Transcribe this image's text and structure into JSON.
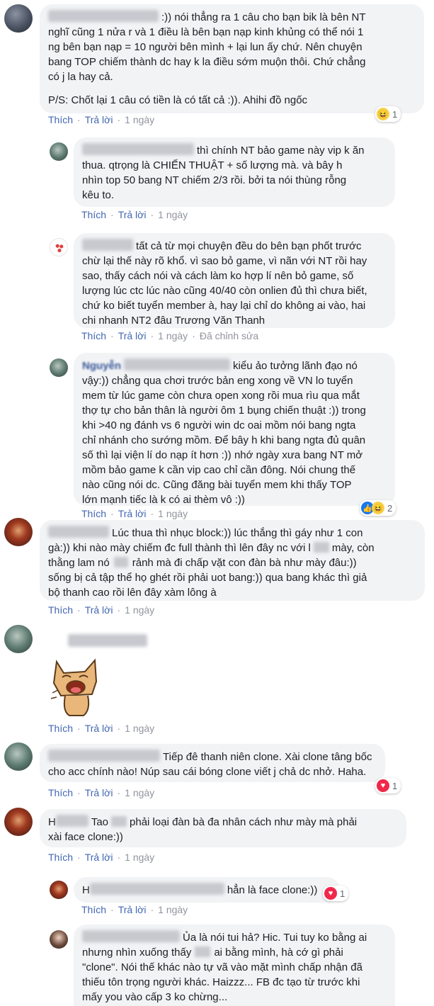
{
  "labels": {
    "like": "Thích",
    "reply": "Trả lời",
    "edited": "Đã chỉnh sửa"
  },
  "comments": [
    {
      "time": "1 ngày",
      "text": ":)) nói thẳng ra 1 câu cho bạn bik là bên NT\nnghĩ cũng 1 nửa r và 1 điều là bên bạn nạp kinh khủng có thể nói 1\nng bên bạn nạp = 10 người bên mình + lại lun ấy chứ. Nên chuyện\nbang TOP chiếm thành dc hay k la điều sớm muộn thôi. Chứ chẳng\ncó j la hay cả.",
      "text2": "P/S: Chốt lại 1 câu có tiền là có tất cả :)). Ahihi đồ ngốc",
      "reaction_count": "1"
    },
    {
      "time": "1 ngày",
      "text": "thì chính NT bảo game này vip k ăn\nthua. qtrọng là CHIẾN THUẬT + số lượng mà. và bây h\nnhìn top 50 bang NT chiếm 2/3 rồi. bởi ta nói thùng rỗng\nkêu to."
    },
    {
      "time": "1 ngày",
      "text": "tất cả từ mọi chuyện đều do bên bạn phốt trước\nchừ lại thế này rõ khổ. vì sao bỏ game, vì nãn với NT rồi hay\nsao, thấy cách nói và cách làm ko hợp lí nên bỏ game, số\nlượng lúc ctc lúc nào cũng 40/40 còn onlien đủ thì chưa biết,\nchứ ko biết tuyển member à, hay lại chỉ do không ai vào, hai\nchi nhanh NT2 đâu Trương Văn Thanh"
    },
    {
      "time": "1 ngày",
      "name_visible": "Nguyễn",
      "text": "kiểu ảo tưởng lãnh đạo nó\nvậy:)) chẳng qua chơi trước bản eng xong về VN lo tuyển\nmem từ lúc game còn chưa open xong rồi mua rìu qua mắt\nthợ tự cho bản thân là người ôm 1 bụng chiến thuật :)) trong\nkhi >40 ng đánh vs 6 người win dc oai mồm nói bang ngta\nchỉ nhánh cho sướng mồm. Để bây h khi bang ngta đủ quân\nsố thì lại viện lí do nạp ít hơn :)) nhớ ngày xưa bang NT mở\nmồm bảo game k cần vip cao chỉ cần đông. Nói chung thế\nnào cũng nói dc. Cũng đăng bài tuyển mem khi thấy TOP\nlớn mạnh tiếc là k có ai thèm vô :))",
      "reaction_count": "2"
    },
    {
      "time": "1 ngày",
      "text_a": "Lúc thua thì nhục block:)) lúc thắng thì gáy như 1 con",
      "text_b": "gà:)) khi nào mày chiếm đc full thành thì lên đây nc với l",
      "text_b2": "mày, còn",
      "text_c": "thằng lam nó",
      "text_c2": "rảnh mà đi chấp vặt con đàn bà như mày đâu:))",
      "text_d": "sống bị cả tập thể họ ghét rồi phải uot bang:)) qua bang khác thì giả\nbộ thanh cao rồi lên đây xàm lông à"
    },
    {
      "time": "1 ngày"
    },
    {
      "time": "1 ngày",
      "text": "Tiếp đê thanh niên clone. Xài clone tâng bốc\ncho acc chính nào! Núp sau cái bóng clone viết j chả dc nhở. Haha.",
      "reaction_count": "1"
    },
    {
      "time": "1 ngày",
      "initial": "H",
      "text_a": "Tao",
      "text_b": "phải loại đàn bà đa nhân cách như mày mà phải",
      "text_c": "xài face clone:))"
    },
    {
      "time": "1 ngày",
      "initial": "H",
      "text": "hẳn là face clone:))",
      "reaction_count": "1"
    },
    {
      "text_a": "Ủa là nói tui hả? Hic. Tui tuy ko bằng ai",
      "text_b": "nhưng nhìn xuống thấy",
      "text_b2": "ai bằng mình, hà cớ gì phải",
      "text_c": "\"clone\". Nói thế khác nào tự vã vào mặt mình chấp nhận đã\nthiếu tôn trọng người khác. Haizzz... FB đc tạo từ trước khi\nmấy you vào cấp 3 ko chừng..."
    }
  ],
  "colors": {
    "link": "#4267b2",
    "bubble": "#f2f3f5",
    "meta": "#90949c"
  },
  "icons": [
    "haha-icon",
    "heart-icon",
    "like-icon",
    "cat-sticker"
  ]
}
